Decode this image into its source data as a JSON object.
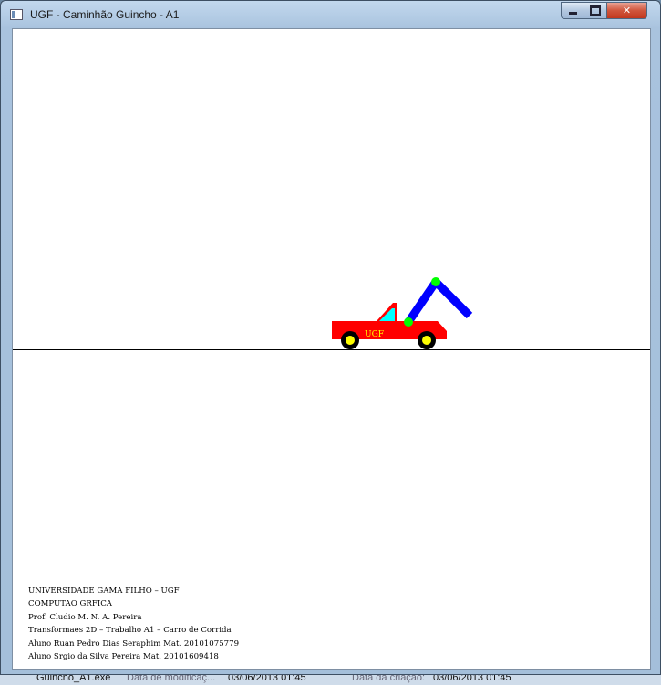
{
  "window": {
    "title": "UGF - Caminhão Guincho - A1",
    "controls": {
      "minimize": "minimize",
      "maximize": "maximize",
      "close": "✕"
    }
  },
  "scene": {
    "truck_label": "UGF",
    "colors": {
      "truck_body": "#ff0000",
      "cabin_window": "#00ffff",
      "crane_arm": "#0000ff",
      "crane_joint": "#00ff00",
      "wheel_tire": "#000000",
      "wheel_hub": "#ffff00",
      "label_text": "#ffff00",
      "ground_line": "#000000"
    }
  },
  "credits": [
    "UNIVERSIDADE GAMA FILHO – UGF",
    "COMPUTAO GRFICA",
    "Prof. Cludio M. N. A. Pereira",
    "Transformaes 2D – Trabalho A1 – Carro de Corrida",
    "Aluno Ruan Pedro Dias Seraphim Mat. 20101075779",
    "Aluno Srgio da Silva Pereira  Mat. 20101609418"
  ],
  "taskbar": {
    "file_name": "Guincho_A1.exe",
    "modified_label": "Data de modificaç...",
    "modified_value": "03/06/2013 01:45",
    "created_label": "Data da criação:",
    "created_value": "03/06/2013 01:45"
  }
}
